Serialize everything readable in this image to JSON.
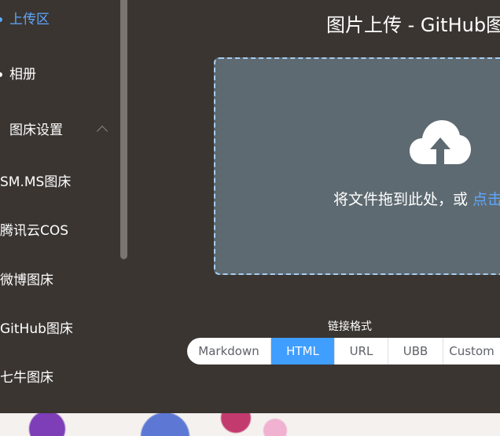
{
  "sidebar": {
    "items": [
      {
        "label": "上传区",
        "active": true
      },
      {
        "label": "相册"
      },
      {
        "label": "图床设置",
        "expanded": true
      },
      {
        "label": "SM.MS图床"
      },
      {
        "label": "腾讯云COS"
      },
      {
        "label": "微博图床"
      },
      {
        "label": "GitHub图床"
      },
      {
        "label": "七牛图床"
      }
    ]
  },
  "main": {
    "title": "图片上传 - GitHub图",
    "dropzone": {
      "text": "将文件拖到此处，或 ",
      "link": "点击",
      "icon": "cloud-upload-icon"
    },
    "link_format": {
      "label": "链接格式",
      "options": [
        "Markdown",
        "HTML",
        "URL",
        "UBB",
        "Custom"
      ],
      "selected": "HTML"
    }
  },
  "colors": {
    "background": "#3a3531",
    "accent": "#409eff",
    "link": "#5ea7ff",
    "dropzone": "#5e6a71"
  }
}
